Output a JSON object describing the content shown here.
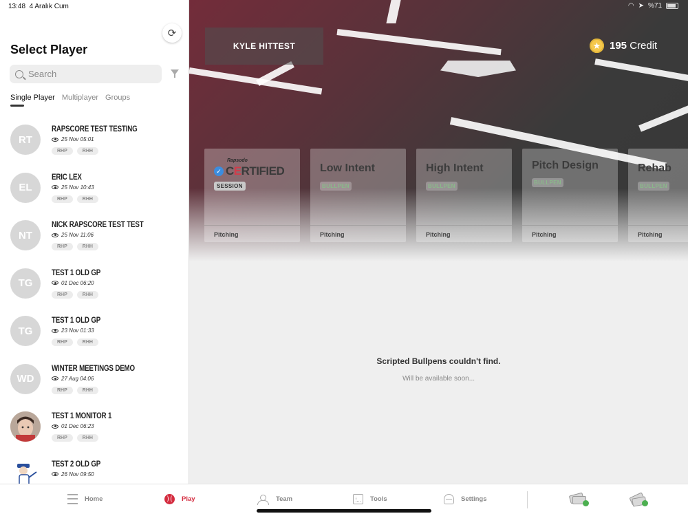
{
  "status_bar": {
    "time": "13:48",
    "date": "4 Aralık Cum",
    "battery": "%71"
  },
  "sidebar": {
    "title": "Select Player",
    "search_placeholder": "Search",
    "tabs": [
      "Single Player",
      "Multiplayer",
      "Groups"
    ],
    "players": [
      {
        "initials": "RT",
        "name": "RAPSCORE TEST TESTING",
        "date": "25 Nov 05:01",
        "badges": [
          "RHP",
          "RHH"
        ],
        "avatar_type": "initials"
      },
      {
        "initials": "EL",
        "name": "ERIC LEX",
        "date": "25 Nov 10:43",
        "badges": [
          "RHP",
          "RHH"
        ],
        "avatar_type": "initials"
      },
      {
        "initials": "NT",
        "name": "NICK RAPSCORE TEST TEST",
        "date": "25 Nov 11:06",
        "badges": [
          "RHP",
          "RHH"
        ],
        "avatar_type": "initials"
      },
      {
        "initials": "TG",
        "name": "TEST 1 OLD GP",
        "date": "01 Dec 06:20",
        "badges": [
          "RHP",
          "RHH"
        ],
        "avatar_type": "initials"
      },
      {
        "initials": "TG",
        "name": "TEST 1 OLD GP",
        "date": "23 Nov 01:33",
        "badges": [
          "RHP",
          "RHH"
        ],
        "avatar_type": "initials"
      },
      {
        "initials": "WD",
        "name": "WINTER MEETINGS DEMO",
        "date": "27 Aug 04:06",
        "badges": [
          "RHP",
          "RHH"
        ],
        "avatar_type": "initials"
      },
      {
        "initials": "",
        "name": "TEST 1 MONITOR 1",
        "date": "01 Dec 06:23",
        "badges": [
          "RHP",
          "RHH"
        ],
        "avatar_type": "photo"
      },
      {
        "initials": "",
        "name": "TEST 2 OLD GP",
        "date": "26 Nov 09:50",
        "badges": [],
        "avatar_type": "mascot"
      }
    ]
  },
  "hero": {
    "player_name": "KYLE  HITTEST",
    "credit_amount": "195",
    "credit_label": "Credit",
    "cards": [
      {
        "type": "certified",
        "brand": "Rapsodo",
        "word_pre": "C",
        "word_accent": "E",
        "word_post": "RTIFIED",
        "badge": "SESSION",
        "footer": "Pitching"
      },
      {
        "type": "normal",
        "title": "Low Intent",
        "badge": "BULLPEN",
        "footer": "Pitching"
      },
      {
        "type": "normal",
        "title": "High Intent",
        "badge": "BULLPEN",
        "footer": "Pitching"
      },
      {
        "type": "pd",
        "title": "Pitch Design",
        "badge": "BULLPEN",
        "footer": "Pitching"
      },
      {
        "type": "normal",
        "title": "Rehab",
        "badge": "BULLPEN",
        "footer": "Pitching"
      }
    ]
  },
  "empty_state": {
    "title": "Scripted Bullpens couldn't find.",
    "subtitle": "Will be available soon..."
  },
  "bottom_nav": {
    "items": [
      {
        "label": "Home",
        "icon": "home-icon"
      },
      {
        "label": "Play",
        "icon": "baseball-icon",
        "active": true
      },
      {
        "label": "Team",
        "icon": "team-icon"
      },
      {
        "label": "Tools",
        "icon": "tools-icon"
      },
      {
        "label": "Settings",
        "icon": "helmet-icon"
      }
    ]
  },
  "colors": {
    "accent": "#d42c3f",
    "bullpen_badge": "#8ab98a",
    "coin": "#f5c84c"
  }
}
